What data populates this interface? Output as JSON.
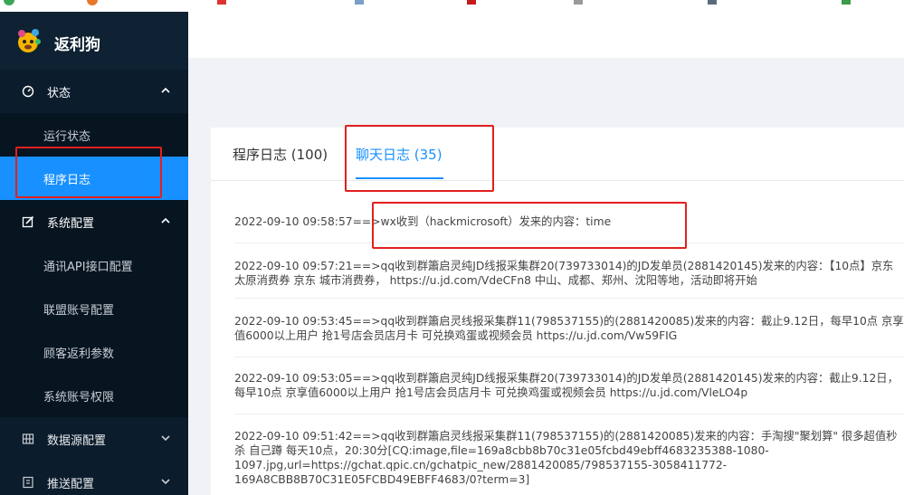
{
  "colors": {
    "sidebar_bg": "#0b1c2c",
    "submenu_bg": "#071521",
    "active_item": "#1890ff",
    "tab_active": "#1890ff",
    "highlight_border": "#e2201d"
  },
  "brand": {
    "name": "返利狗",
    "logo_icon": "dog-mascot-icon"
  },
  "sidebar": {
    "status": {
      "label": "状态",
      "icon": "dashboard-icon",
      "expanded": true,
      "items": [
        {
          "label": "运行状态"
        },
        {
          "label": "程序日志",
          "active": true
        }
      ]
    },
    "system_config": {
      "label": "系统配置",
      "icon": "edit-icon",
      "expanded": true,
      "items": [
        {
          "label": "通讯API接口配置"
        },
        {
          "label": "联盟账号配置"
        },
        {
          "label": "顾客返利参数"
        },
        {
          "label": "系统账号权限"
        }
      ]
    },
    "data_source": {
      "label": "数据源配置",
      "icon": "grid-icon"
    },
    "push": {
      "label": "推送配置",
      "icon": "list-icon"
    }
  },
  "tabs": {
    "program_log": "程序日志 (100)",
    "chat_log": "聊天日志 (35)",
    "active": "chat_log"
  },
  "logs": [
    "2022-09-10 09:58:57==>wx收到（hackmicrosoft）发来的内容：time",
    "2022-09-10 09:57:21==>qq收到群簫启灵纯JD线报采集群20(739733014)的JD发单员(2881420145)发来的内容：【10点】京东太原消费券 京东 城市消费券， https://u.jd.com/VdeCFn8 中山、成都、郑州、沈阳等地，活动即将开始",
    "2022-09-10 09:53:45==>qq收到群簫启灵线报采集群11(798537155)的(2881420085)发来的内容：截止9.12日，每早10点 京享值6000以上用户 抢1号店会员店月卡 可兑换鸡蛋或视频会员 https://u.jd.com/Vw59FIG",
    "2022-09-10 09:53:05==>qq收到群簫启灵纯JD线报采集群20(739733014)的JD发单员(2881420145)发来的内容：截止9.12日，每早10点 京享值6000以上用户 抢1号店会员店月卡 可兑换鸡蛋或视频会员 https://u.jd.com/VleLO4p",
    "2022-09-10 09:51:42==>qq收到群簫启灵线报采集群11(798537155)的(2881420085)发来的内容：手淘搜\"聚划算\" 很多超值秒杀 自己蹲 每天10点，20:30分[CQ:image,file=169a8cbb8b70c31e05fcbd49ebff4683235388-1080-1097.jpg,url=https://gchat.qpic.cn/gchatpic_new/2881420085/798537155-3058411772-169A8CBB8B70C31E05FCBD49EBFF4683/0?term=3]"
  ]
}
